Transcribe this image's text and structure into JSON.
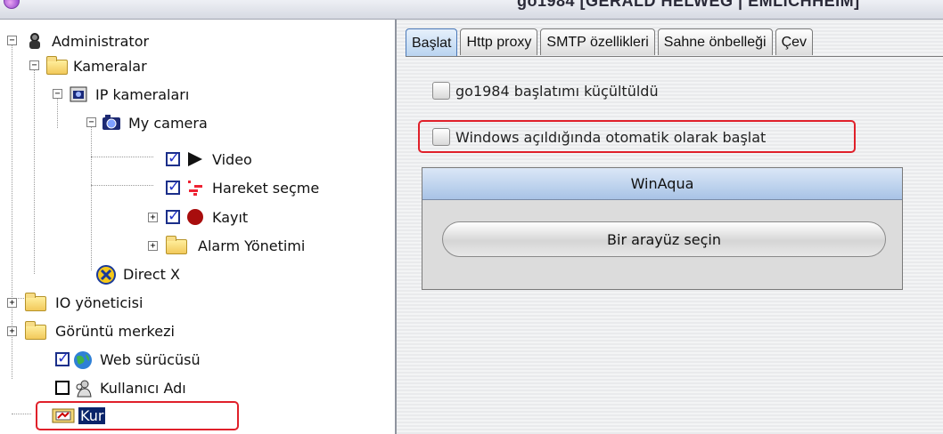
{
  "window": {
    "title": "go1984 [GERALD HELWEG | EMLICHHEIM]"
  },
  "tree": {
    "items": [
      {
        "label": "Administrator",
        "icon": "admin-icon"
      },
      {
        "label": "Kameralar",
        "icon": "folder-open-icon"
      },
      {
        "label": "IP kameraları",
        "icon": "ip-camera-icon"
      },
      {
        "label": "My camera",
        "icon": "camera-icon"
      },
      {
        "label": "Video",
        "icon": "play-icon",
        "checked": true
      },
      {
        "label": "Hareket seçme",
        "icon": "motion-icon",
        "checked": true
      },
      {
        "label": "Kayıt",
        "icon": "record-icon",
        "checked": true
      },
      {
        "label": "Alarm Yönetimi",
        "icon": "folder-icon"
      },
      {
        "label": "Direct X",
        "icon": "directx-icon"
      },
      {
        "label": "IO yöneticisi",
        "icon": "folder-icon"
      },
      {
        "label": "Görüntü merkezi",
        "icon": "folder-icon"
      },
      {
        "label": "Web sürücüsü",
        "icon": "globe-icon",
        "checked": true
      },
      {
        "label": "Kullanıcı Adı",
        "icon": "users-icon",
        "checked": false
      },
      {
        "label": "Kur",
        "icon": "setup-icon",
        "selected": true
      }
    ]
  },
  "tabs": [
    "Başlat",
    "Http proxy",
    "SMTP özellikleri",
    "Sahne önbelleği",
    "Çev"
  ],
  "options": {
    "minimized_start": "go1984 başlatımı küçültüldü",
    "autostart_windows": "Windows açıldığında otomatik olarak başlat"
  },
  "laf": {
    "header": "WinAqua",
    "button": "Bir arayüz seçin"
  },
  "colors": {
    "highlight_box": "#e0202a",
    "selection": "#0a246a",
    "active_tab": "#b8d3f0"
  }
}
